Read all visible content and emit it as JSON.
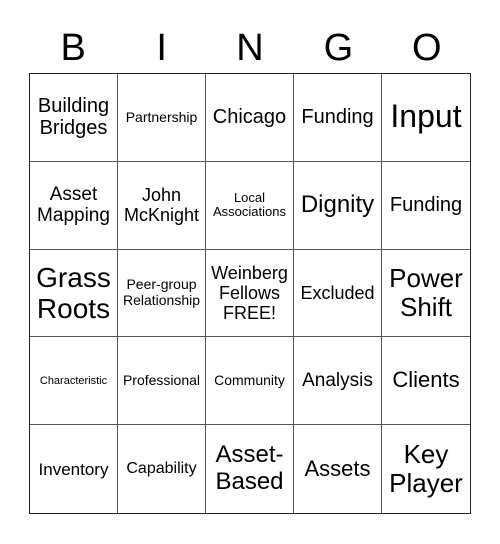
{
  "header": {
    "letters": [
      "B",
      "I",
      "N",
      "G",
      "O"
    ]
  },
  "board": {
    "cells": [
      "Building Bridges",
      "Partnership",
      "Chicago",
      "Funding",
      "Input",
      "Asset Mapping",
      "John McKnight",
      "Local Associations",
      "Dignity",
      "Funding",
      "Grass Roots",
      "Peer-group Relationship",
      "Weinberg Fellows FREE!",
      "Excluded",
      "Power Shift",
      "Characteristic",
      "Professional",
      "Community",
      "Analysis",
      "Clients",
      "Inventory",
      "Capability",
      "Asset-Based",
      "Assets",
      "Key Player"
    ]
  }
}
